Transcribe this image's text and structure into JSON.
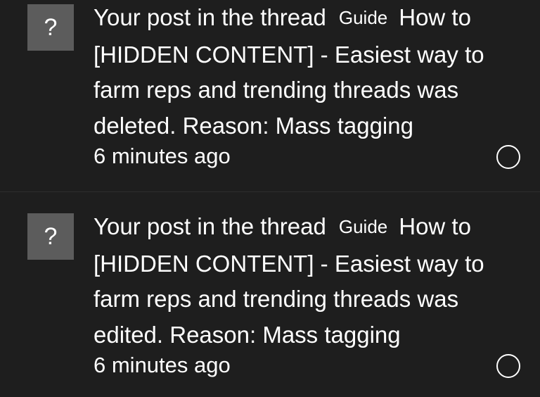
{
  "alerts": [
    {
      "avatar_text": "?",
      "line1_pre": "Your post in the thread",
      "label": "Guide",
      "line1_post": "How to",
      "line2": "[HIDDEN CONTENT] - Easiest way to",
      "line3": "farm reps and trending threads was",
      "line4": "deleted. Reason: Mass tagging",
      "time": "6 minutes ago"
    },
    {
      "avatar_text": "?",
      "line1_pre": "Your post in the thread",
      "label": "Guide",
      "line1_post": "How to",
      "line2": "[HIDDEN CONTENT] - Easiest way to",
      "line3": "farm reps and trending threads was",
      "line4": "edited. Reason: Mass tagging",
      "time": "6 minutes ago"
    }
  ]
}
